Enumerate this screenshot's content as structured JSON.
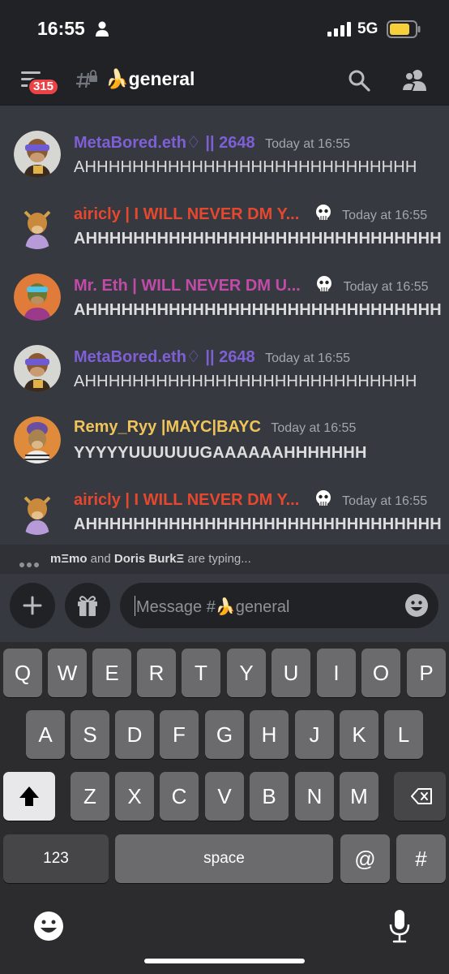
{
  "status_bar": {
    "time": "16:55",
    "network": "5G"
  },
  "header": {
    "badge_count": "315",
    "channel_name": "🍌general",
    "icons": [
      "hamburger-icon",
      "locked-hash-icon",
      "search-icon",
      "members-icon"
    ]
  },
  "messages": [
    {
      "author": "MetaBored.eth♢ || 2648",
      "author_color": "#7e5fd6",
      "timestamp": "Today at 16:55",
      "text": "AHHHHHHHHHHHHHHHHHHHHHHHHHHHH",
      "bold": false,
      "role_icon": false
    },
    {
      "author": "airicly | I WILL NEVER DM Y...",
      "author_color": "#e5482f",
      "timestamp": "Today at 16:55",
      "text": "AHHHHHHHHHHHHHHHHHHHHHHHHHHHHHH",
      "bold": true,
      "role_icon": true
    },
    {
      "author": "Mr. Eth | WILL NEVER DM U...",
      "author_color": "#c24ba8",
      "timestamp": "Today at 16:55",
      "text": "AHHHHHHHHHHHHHHHHHHHHHHHHHHHHHH",
      "bold": true,
      "role_icon": true
    },
    {
      "author": "MetaBored.eth♢ || 2648",
      "author_color": "#7e5fd6",
      "timestamp": "Today at 16:55",
      "text": "AHHHHHHHHHHHHHHHHHHHHHHHHHHHH",
      "bold": false,
      "role_icon": false
    },
    {
      "author": "Remy_Ryy |MAYC|BAYC",
      "author_color": "#f0c45a",
      "timestamp": "Today at 16:55",
      "text": "YYYYYUUUUUUGAAAAAAHHHHHHH",
      "bold": true,
      "role_icon": false
    },
    {
      "author": "airicly | I WILL NEVER DM Y...",
      "author_color": "#e5482f",
      "timestamp": "Today at 16:55",
      "text": "AHHHHHHHHHHHHHHHHHHHHHHHHHHHHHH",
      "bold": true,
      "role_icon": true
    }
  ],
  "typing": {
    "user1": "mΞmo",
    "and": "and",
    "user2": "Doris BurkΞ",
    "suffix": "are typing..."
  },
  "composer": {
    "placeholder": "Message #🍌general"
  },
  "keyboard": {
    "row1": [
      "Q",
      "W",
      "E",
      "R",
      "T",
      "Y",
      "U",
      "I",
      "O",
      "P"
    ],
    "row2": [
      "A",
      "S",
      "D",
      "F",
      "G",
      "H",
      "J",
      "K",
      "L"
    ],
    "row3": [
      "Z",
      "X",
      "C",
      "V",
      "B",
      "N",
      "M"
    ],
    "numbers_label": "123",
    "space_label": "space",
    "at_label": "@",
    "hash_label": "#"
  },
  "colors": {
    "background": "#36393f",
    "header": "#202225",
    "badge": "#ed4245",
    "keyboard": "#2c2c2e"
  }
}
